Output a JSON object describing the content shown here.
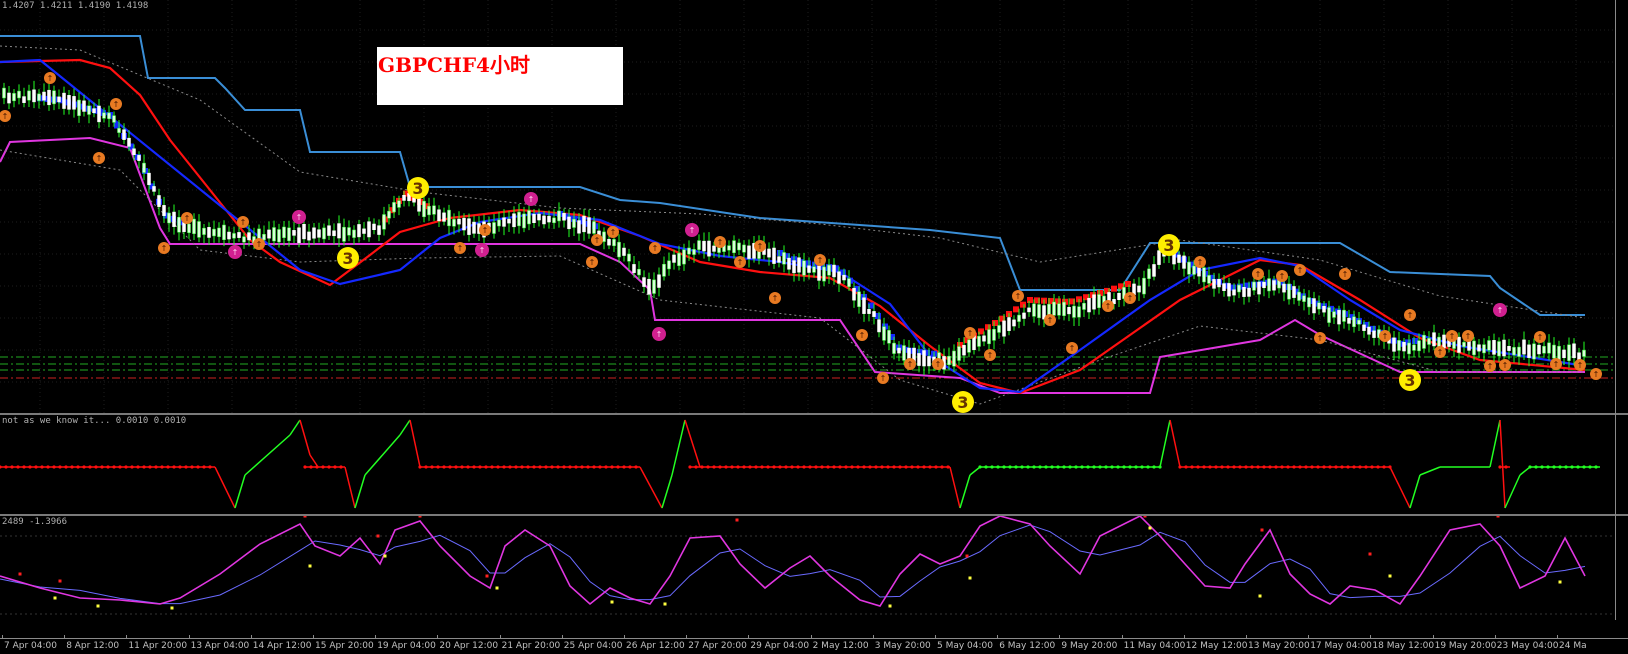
{
  "main_pane": {
    "ohlc": "1.4207 1.4211 1.4190 1.4198",
    "title": "GBPCHF4小时",
    "colors": {
      "upper_channel": "#3a8ed6",
      "lower_channel": "#e036e0",
      "red_ma": "#ff1010",
      "blue_ma": "#1428ff",
      "candle_up": "#d9ffd9",
      "candle_down": "#ffffff",
      "wick": "#22ff22",
      "fractal_orange": "#e87a22",
      "fractal_pink": "#d02090",
      "wave_marker": "#ffee00"
    },
    "wave_marker_label": "3",
    "fractal_glyph": "↑"
  },
  "indicator_pane": {
    "label": "not as we know it... 0.0010 0.0010"
  },
  "stoch_pane": {
    "label": "2489 -1.3966"
  },
  "time_axis": [
    "7 Apr 04:00",
    "8 Apr 12:00",
    "11 Apr 20:00",
    "13 Apr 04:00",
    "14 Apr 12:00",
    "15 Apr 20:00",
    "19 Apr 04:00",
    "20 Apr 12:00",
    "21 Apr 20:00",
    "25 Apr 04:00",
    "26 Apr 12:00",
    "27 Apr 20:00",
    "29 Apr 04:00",
    "2 May 12:00",
    "3 May 20:00",
    "5 May 04:00",
    "6 May 12:00",
    "9 May 20:00",
    "11 May 04:00",
    "12 May 12:00",
    "13 May 20:00",
    "17 May 04:00",
    "18 May 12:00",
    "19 May 20:00",
    "23 May 04:00",
    "24 Ma"
  ]
}
